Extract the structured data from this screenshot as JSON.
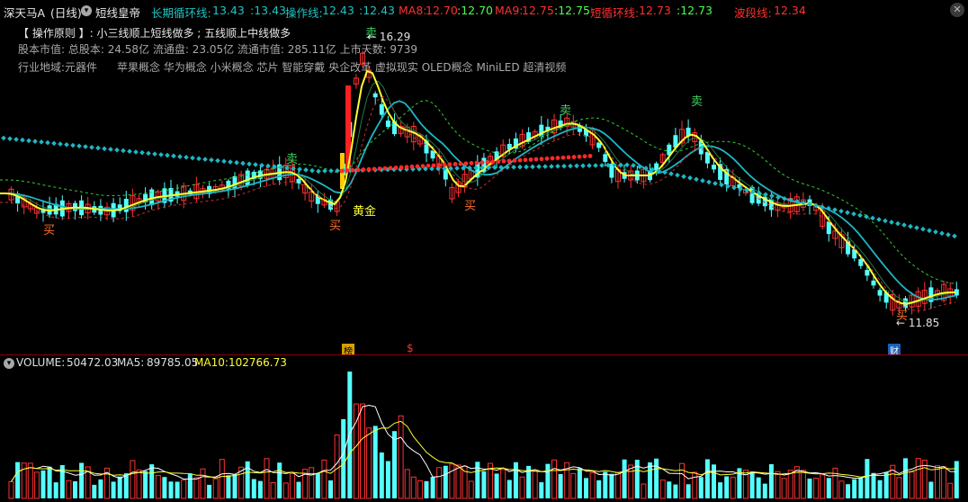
{
  "header": {
    "stock_name": "深天马A",
    "period": "(日线)",
    "toggle_icon": "chevron-down-icon",
    "indicator_name": "短线皇帝",
    "indicators": [
      {
        "label": "长期循环线:",
        "value": "13.43",
        "value2": ":13.43",
        "color": "#1fc4c4"
      },
      {
        "label": "操作线:",
        "value": "12.43",
        "value2": ":12.43",
        "color": "#1fc4c4"
      },
      {
        "label": "MA8:",
        "value": "12.70",
        "value2": ":12.70",
        "color": "#ff3030"
      },
      {
        "label": "MA9:",
        "value": "12.75",
        "value2": ":12.75",
        "color": "#ff3030"
      },
      {
        "label": "短循环线:",
        "value": "12.73",
        "value2": ":12.73",
        "color": "#ff3030"
      },
      {
        "label": "波段线:",
        "value": "12.34",
        "color": "#ff3030"
      }
    ],
    "close_icon": "close-icon"
  },
  "info": {
    "principle": "【 操作原则 】: 小三线顺上短线做多 ; 五线顺上中线做多",
    "market_value": "股本市值: 总股本: 24.58亿 流通盘: 23.05亿 流通市值: 285.11亿 上市天数: 9739",
    "industry": "行业地域:元器件",
    "concepts": "苹果概念 华为概念 小米概念 芯片 智能穿戴 央企改革 虚拟现实 OLED概念 MiniLED 超清视频"
  },
  "chart_annotations": {
    "high_price": "16.29",
    "low_price": "11.85",
    "golden_cross": "黄金",
    "buy": "买",
    "sell": "卖",
    "marker_rank": "榜",
    "marker_money": "$",
    "marker_finance": "财"
  },
  "volume_panel": {
    "label": "VOLUME:",
    "value": "50472.03",
    "ma5_label": "MA5:",
    "ma5": "89785.05",
    "ma10_label": "MA10:",
    "ma10": "102766.73"
  },
  "colors": {
    "up": "#ff3232",
    "down": "#54ffff",
    "ma_yellow": "#ffff00",
    "cycle_line": "#1fb7c4",
    "sell_text": "#3fd060",
    "buy_text": "#ff7030"
  }
}
